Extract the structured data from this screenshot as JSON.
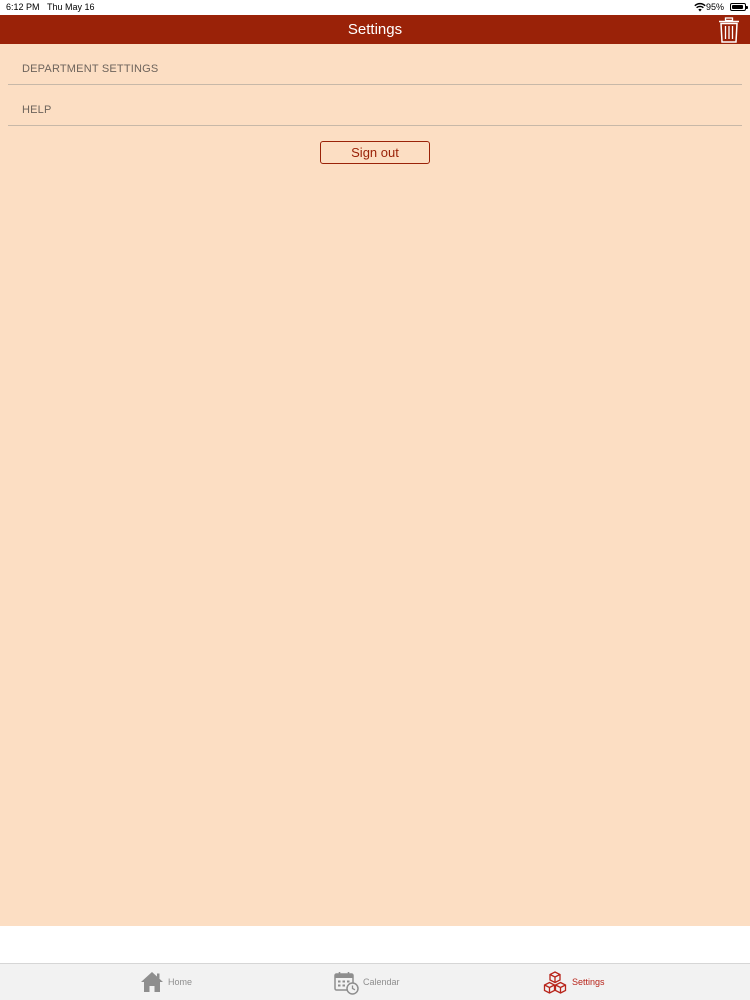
{
  "status_bar": {
    "time": "6:12 PM",
    "date": "Thu May 16",
    "battery_percent": "95%"
  },
  "nav_bar": {
    "title": "Settings",
    "trash_icon": "trash-icon"
  },
  "menu": {
    "items": [
      {
        "label": "DEPARTMENT SETTINGS"
      },
      {
        "label": "HELP"
      }
    ]
  },
  "sign_out_label": "Sign out",
  "tab_bar": {
    "tabs": [
      {
        "label": "Home",
        "icon": "home-icon",
        "selected": false
      },
      {
        "label": "Calendar",
        "icon": "calendar-clock-icon",
        "selected": false
      },
      {
        "label": "Settings",
        "icon": "cubes-icon",
        "selected": true
      }
    ]
  },
  "colors": {
    "nav_background": "#9a2208",
    "content_background": "#fcdec3",
    "accent": "#b8241a",
    "inactive_tab": "#8e8e8e"
  }
}
